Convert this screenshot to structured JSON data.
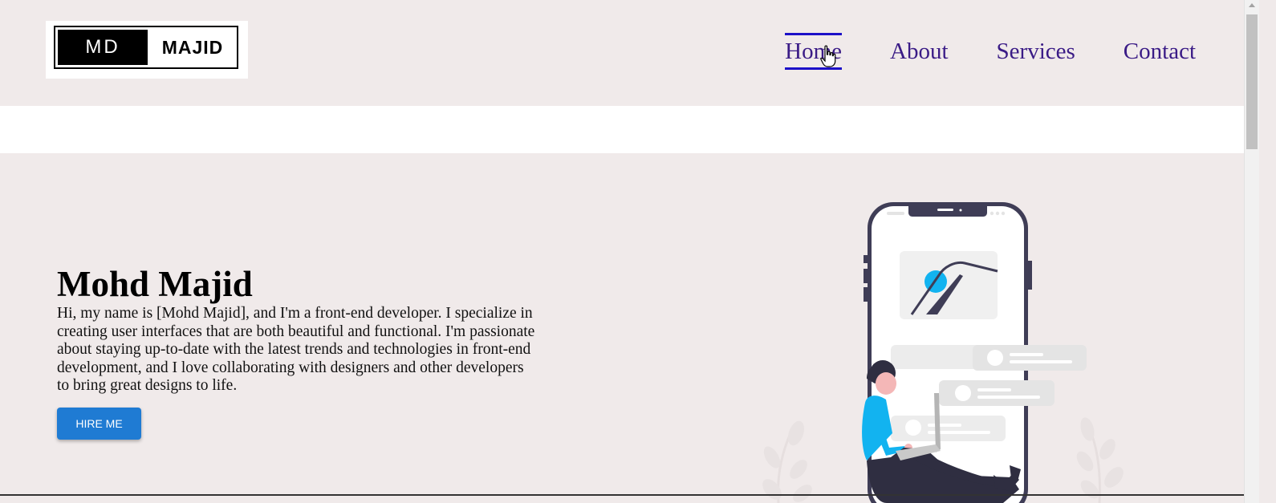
{
  "logo": {
    "left_text": "MD",
    "right_text": "MAJID"
  },
  "nav": {
    "items": [
      {
        "label": "Home",
        "active": true
      },
      {
        "label": "About"
      },
      {
        "label": "Services"
      },
      {
        "label": "Contact"
      }
    ]
  },
  "hero": {
    "title": "Mohd Majid",
    "description": "Hi, my name is [Mohd Majid], and I'm a front-end developer. I specialize in creating user interfaces that are both beautiful and functional. I'm passionate about staying up-to-date with the latest trends and technologies in front-end development, and I love collaborating with designers and other developers to bring great designs to life.",
    "button_label": "HIRE ME"
  },
  "colors": {
    "background": "#f0eaea",
    "nav_text": "#3a1b86",
    "nav_active_underline": "#1c10c8",
    "button": "#1f7bd3",
    "accent_illustration": "#12b3f0"
  }
}
